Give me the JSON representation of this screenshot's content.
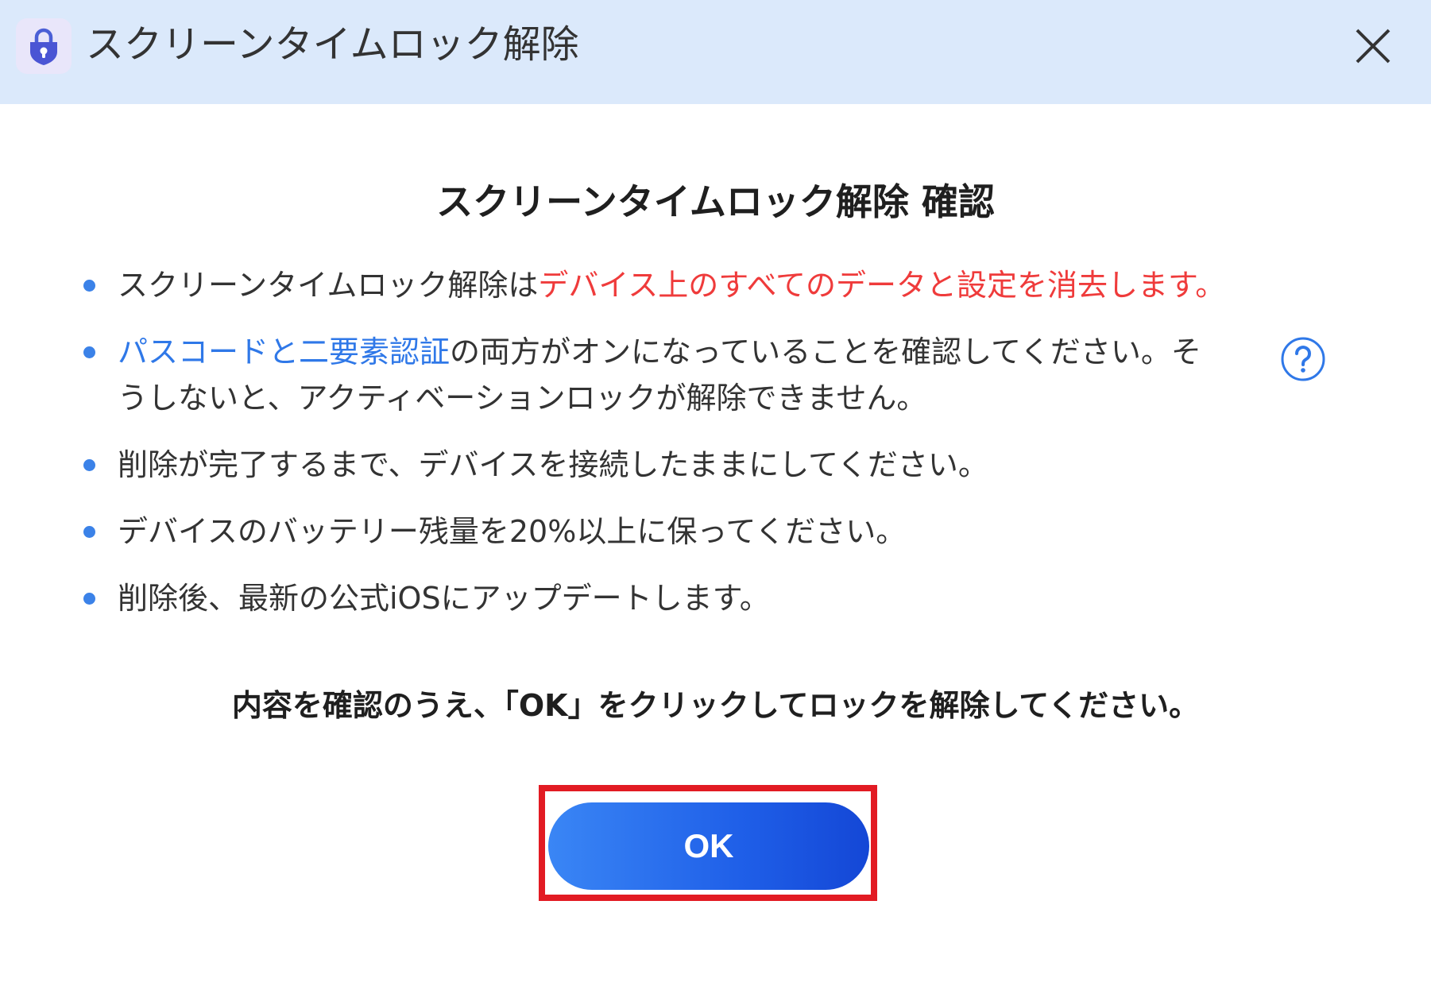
{
  "window": {
    "title": "スクリーンタイムロック解除",
    "app_icon": "lock-shield-icon",
    "close_icon": "close-icon"
  },
  "dialog": {
    "heading": "スクリーンタイムロック解除 確認",
    "bullets": [
      {
        "prefix": "スクリーンタイムロック解除は",
        "highlight": "デバイス上のすべてのデータと設定を消去します。"
      },
      {
        "link": "パスコードと二要素認証",
        "line1": "の両方がオンになっていることを確認してください。そ",
        "line2": "うしないと、アクティベーションロックが解除できません。"
      },
      {
        "text": "削除が完了するまで、デバイスを接続したままにしてください。"
      },
      {
        "text": "デバイスのバッテリー残量を20%以上に保ってください。"
      },
      {
        "text": "削除後、最新の公式iOSにアップデートします。"
      }
    ],
    "help_icon": "question-circle-icon",
    "confirm_note": "内容を確認のうえ、「OK」をクリックしてロックを解除してください。",
    "ok_label": "OK"
  },
  "colors": {
    "titlebar_bg": "#dbe9fb",
    "warning_red": "#ef3b3b",
    "link_blue": "#2f78e8",
    "button_blue": "#1f5fe8",
    "highlight_red": "#e21b23"
  }
}
